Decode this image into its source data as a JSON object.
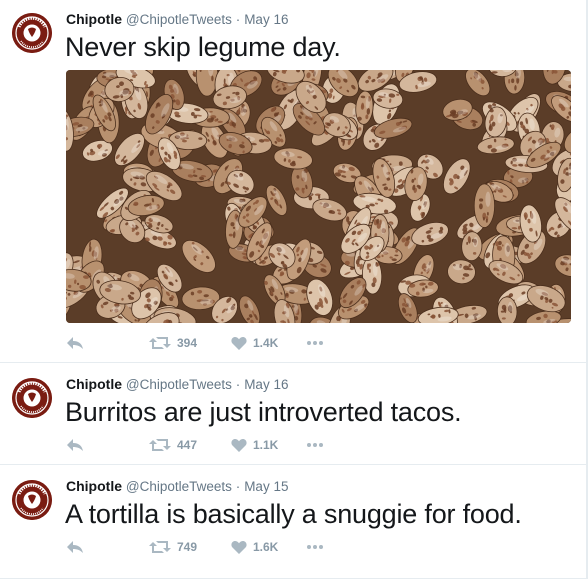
{
  "account": {
    "name": "Chipotle",
    "handle": "@ChipotleTweets",
    "separator": "·",
    "avatar_text": "CHIPOTLE MEXICAN GRILL"
  },
  "colors": {
    "avatar_bg": "#7a1c12",
    "avatar_ring": "#ffffff",
    "meta_text": "#657786",
    "action_icon": "#aab8c2"
  },
  "icons": {
    "reply": "reply-arrow-icon",
    "retweet": "retweet-icon",
    "like": "heart-icon",
    "more": "more-dots-icon"
  },
  "tweets": [
    {
      "date": "May 16",
      "text": "Never skip legume day.",
      "retweets": "394",
      "likes": "1.4K",
      "media": "pinto-beans-photo"
    },
    {
      "date": "May 16",
      "text": "Burritos are just introverted tacos.",
      "retweets": "447",
      "likes": "1.1K"
    },
    {
      "date": "May 15",
      "text": "A tortilla is basically a snuggie for food.",
      "retweets": "749",
      "likes": "1.6K"
    }
  ]
}
